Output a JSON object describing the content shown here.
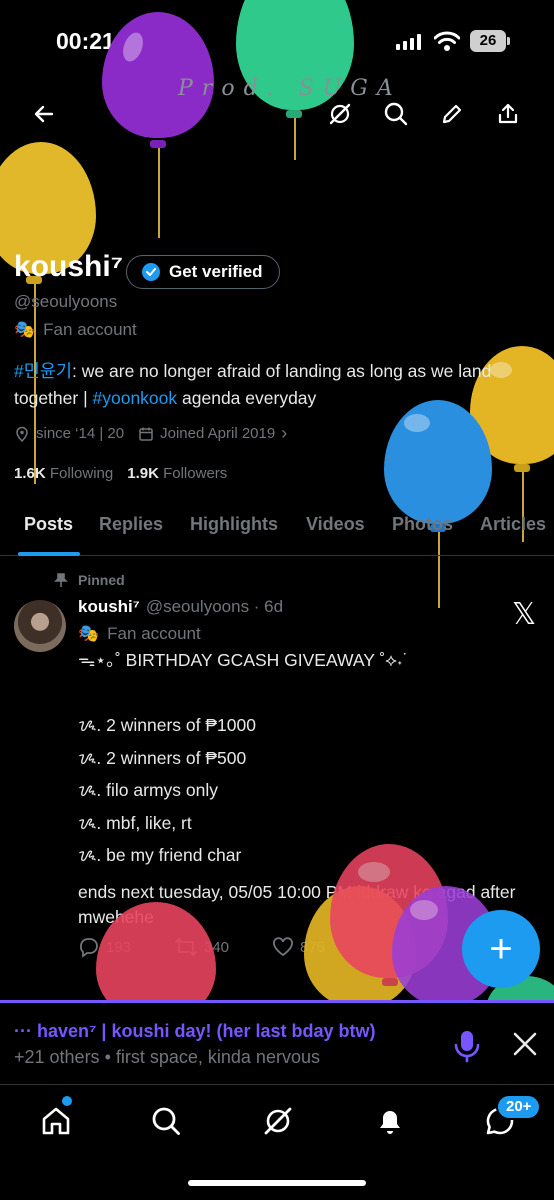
{
  "status_bar": {
    "time": "00:21",
    "battery": "26"
  },
  "header": {
    "overlay_text": "Prod. SUGA"
  },
  "profile": {
    "name": "koushi⁷",
    "verify_label": "Get verified",
    "handle": "@seoulyoons",
    "account_label": "Fan account",
    "bio": {
      "tag1": "#민윤기",
      "text1": ": we are no longer afraid of landing as long as we land together | ",
      "tag2": "#yoonkook",
      "text2": " agenda everyday"
    },
    "location": "since ‘14 | 20",
    "joined": "Joined April 2019",
    "following_count": "1.6K",
    "following_label": "Following",
    "followers_count": "1.9K",
    "followers_label": "Followers"
  },
  "tabs": [
    "Posts",
    "Replies",
    "Highlights",
    "Videos",
    "Photos",
    "Articles"
  ],
  "pinned_post": {
    "pinned_label": "Pinned",
    "author": "koushi⁷",
    "handle_time": "@seoulyoons · 6d",
    "account_label": "Fan account",
    "lines": [
      "ᯓ⋆｡˚ BIRTHDAY GCASH GIVEAWAY ˚⟡˖˙",
      "",
      "ᝰ. 2 winners of ₱1000",
      "ᝰ. 2 winners of ₱500",
      "ᝰ. filo armys only",
      "ᝰ. mbf, like, rt",
      "ᝰ. be my friend char"
    ],
    "ending": "ends next tuesday, 05/05 10:00 PM iddraw ko agad after mwehehe",
    "replies": "193",
    "reposts": "340",
    "likes": "875"
  },
  "compose_button": "+",
  "space": {
    "title": "··· haven⁷ | koushi day! (her last bday btw)",
    "subtitle": "+21 others • first space, kinda nervous"
  },
  "bottom_nav": {
    "messages_badge": "20+"
  },
  "colors": {
    "accent": "#1d9bf0",
    "space": "#7856ff",
    "muted": "#71767b"
  }
}
